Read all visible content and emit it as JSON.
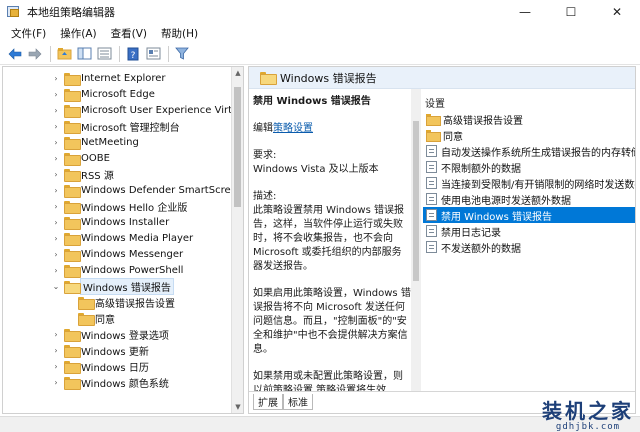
{
  "window": {
    "title": "本地组策略编辑器",
    "controls": [
      "—",
      "☐",
      "✕"
    ]
  },
  "menu": [
    "文件(F)",
    "操作(A)",
    "查看(V)",
    "帮助(H)"
  ],
  "tree": {
    "items": [
      {
        "label": "Internet Explorer",
        "depth": 1,
        "expanded": false,
        "selected": false
      },
      {
        "label": "Microsoft Edge",
        "depth": 1,
        "expanded": false,
        "selected": false
      },
      {
        "label": "Microsoft User Experience Virtualization",
        "depth": 1,
        "expanded": false,
        "selected": false
      },
      {
        "label": "Microsoft 管理控制台",
        "depth": 1,
        "expanded": false,
        "selected": false
      },
      {
        "label": "NetMeeting",
        "depth": 1,
        "expanded": false,
        "selected": false
      },
      {
        "label": "OOBE",
        "depth": 1,
        "expanded": false,
        "selected": false
      },
      {
        "label": "RSS 源",
        "depth": 1,
        "expanded": false,
        "selected": false
      },
      {
        "label": "Windows Defender SmartScreen",
        "depth": 1,
        "expanded": false,
        "selected": false
      },
      {
        "label": "Windows Hello 企业版",
        "depth": 1,
        "expanded": false,
        "selected": false
      },
      {
        "label": "Windows Installer",
        "depth": 1,
        "expanded": false,
        "selected": false
      },
      {
        "label": "Windows Media Player",
        "depth": 1,
        "expanded": false,
        "selected": false
      },
      {
        "label": "Windows Messenger",
        "depth": 1,
        "expanded": false,
        "selected": false
      },
      {
        "label": "Windows PowerShell",
        "depth": 1,
        "expanded": false,
        "selected": false
      },
      {
        "label": "Windows 错误报告",
        "depth": 1,
        "expanded": true,
        "selected": true
      },
      {
        "label": "高级错误报告设置",
        "depth": 2,
        "expanded": false,
        "selected": false
      },
      {
        "label": "同意",
        "depth": 2,
        "expanded": false,
        "selected": false
      },
      {
        "label": "Windows 登录选项",
        "depth": 1,
        "expanded": false,
        "selected": false
      },
      {
        "label": "Windows 更新",
        "depth": 1,
        "expanded": false,
        "selected": false
      },
      {
        "label": "Windows 日历",
        "depth": 1,
        "expanded": false,
        "selected": false
      },
      {
        "label": "Windows 颜色系统",
        "depth": 1,
        "expanded": false,
        "selected": false
      }
    ]
  },
  "right": {
    "header": "Windows 错误报告",
    "description": {
      "title": "禁用 Windows 错误报告",
      "edit_prefix": "编辑",
      "edit_link": "策略设置",
      "requirements_label": "要求:",
      "requirements_value": "Windows Vista 及以上版本",
      "desc_label": "描述:",
      "desc_p1": "此策略设置禁用 Windows 错误报告，这样，当软件停止运行或失败时，将不会收集报告，也不会向 Microsoft 或委托组织的内部服务器发送报告。",
      "desc_p2": "如果启用此策略设置，Windows 错误报告将不向 Microsoft 发送任何问题信息。而且，\"控制面板\"的\"安全和维护\"中也不会提供解决方案信息。",
      "desc_p3": "如果禁用或未配置此策略设置，则以前策略设置 策略设置将生效"
    },
    "settings_header": "设置",
    "settings": [
      {
        "label": "高级错误报告设置",
        "kind": "folder",
        "selected": false
      },
      {
        "label": "同意",
        "kind": "folder",
        "selected": false
      },
      {
        "label": "自动发送操作系统所生成错误报告的内存转储",
        "kind": "policy",
        "selected": false
      },
      {
        "label": "不限制额外的数据",
        "kind": "policy",
        "selected": false
      },
      {
        "label": "当连接到受限制/有开销限制的网络时发送数据",
        "kind": "policy",
        "selected": false
      },
      {
        "label": "使用电池电源时发送额外数据",
        "kind": "policy",
        "selected": false
      },
      {
        "label": "禁用 Windows 错误报告",
        "kind": "policy",
        "selected": true
      },
      {
        "label": "禁用日志记录",
        "kind": "policy",
        "selected": false
      },
      {
        "label": "不发送额外的数据",
        "kind": "policy",
        "selected": false
      }
    ],
    "tabs": [
      "扩展",
      "标准"
    ]
  },
  "watermark": {
    "main": "装机之家",
    "sub": "gdhjbk.com"
  },
  "colors": {
    "selection": "#0078d7",
    "header_bg": "#e9f1fa",
    "folder": "#f2c55c",
    "link": "#0b5cad"
  }
}
